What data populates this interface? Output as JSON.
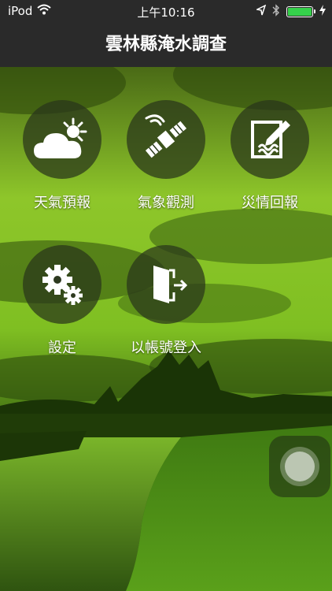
{
  "status_bar": {
    "carrier": "iPod",
    "time": "上午10:16",
    "battery_level": 1.0,
    "battery_color": "#35d14b"
  },
  "nav": {
    "title": "雲林縣淹水調查"
  },
  "menu": [
    {
      "label": "天氣預報",
      "icon": "weather-icon"
    },
    {
      "label": "氣象觀測",
      "icon": "satellite-icon"
    },
    {
      "label": "災情回報",
      "icon": "report-icon"
    },
    {
      "label": "設定",
      "icon": "gears-icon"
    },
    {
      "label": "以帳號登入",
      "icon": "login-icon"
    }
  ],
  "colors": {
    "bar_bg": "#2a2a2a",
    "tint": "#6fbf1a"
  }
}
